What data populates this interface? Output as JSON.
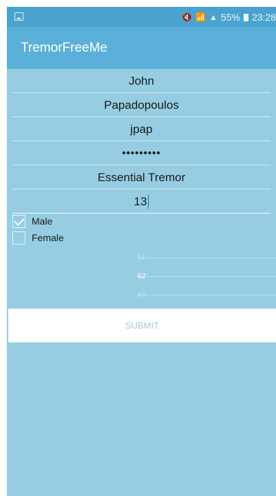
{
  "status_bar": {
    "notification_icon": "gallery-icon",
    "icons": [
      "mute-icon",
      "wifi-icon",
      "signal-icon"
    ],
    "battery_percent": "55%",
    "time": "23:28"
  },
  "app_bar": {
    "title": "TremorFreeMe"
  },
  "form": {
    "first_name": "John",
    "last_name": "Papadopoulos",
    "username": "jpap",
    "password_masked": "•••••••••",
    "condition": "Essential Tremor",
    "years": "13"
  },
  "gender": {
    "male_label": "Male",
    "male_checked": true,
    "female_label": "Female",
    "female_checked": false
  },
  "age_picker": {
    "prev": "61",
    "current": "62",
    "next": "63"
  },
  "submit": {
    "label": "SUBMIT"
  },
  "colors": {
    "accent": "#5ab0d8",
    "status_bar": "#4aa3cf",
    "background": "#96cde2"
  }
}
